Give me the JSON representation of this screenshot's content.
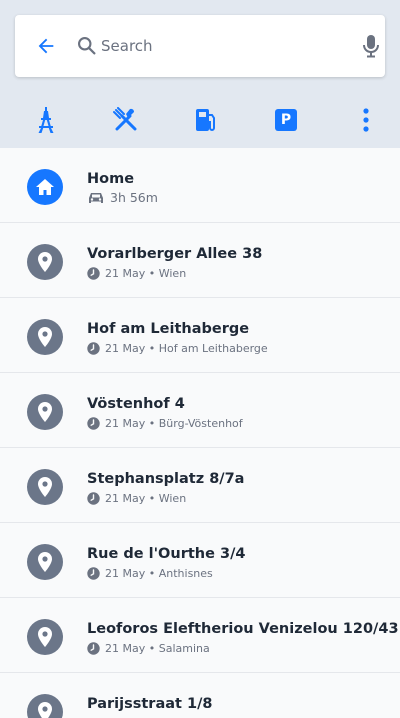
{
  "search": {
    "placeholder": "Search"
  },
  "categories": [
    {
      "name": "attractions",
      "icon": "eiffel-tower-icon"
    },
    {
      "name": "restaurants",
      "icon": "fork-knife-icon"
    },
    {
      "name": "gas-stations",
      "icon": "fuel-pump-icon"
    },
    {
      "name": "parking",
      "icon": "parking-icon",
      "glyph": "P"
    },
    {
      "name": "more",
      "icon": "more-vertical-icon"
    }
  ],
  "colors": {
    "accent": "#1677ff",
    "pin": "#6b7689",
    "header_bg": "#e2e8f0"
  },
  "home": {
    "title": "Home",
    "duration": "3h 56m"
  },
  "recents": [
    {
      "title": "Vorarlberger Allee 38",
      "date": "21 May",
      "place": "Wien"
    },
    {
      "title": "Hof am Leithaberge",
      "date": "21 May",
      "place": "Hof am Leithaberge"
    },
    {
      "title": "Vöstenhof 4",
      "date": "21 May",
      "place": "Bürg-Vöstenhof"
    },
    {
      "title": "Stephansplatz 8/7a",
      "date": "21 May",
      "place": "Wien"
    },
    {
      "title": "Rue de l'Ourthe 3/4",
      "date": "21 May",
      "place": "Anthisnes"
    },
    {
      "title": "Leoforos Eleftheriou Venizelou 120/43",
      "date": "21 May",
      "place": "Salamina"
    },
    {
      "title": "Parijsstraat 1/8",
      "date": "",
      "place": ""
    }
  ],
  "separator": " • "
}
